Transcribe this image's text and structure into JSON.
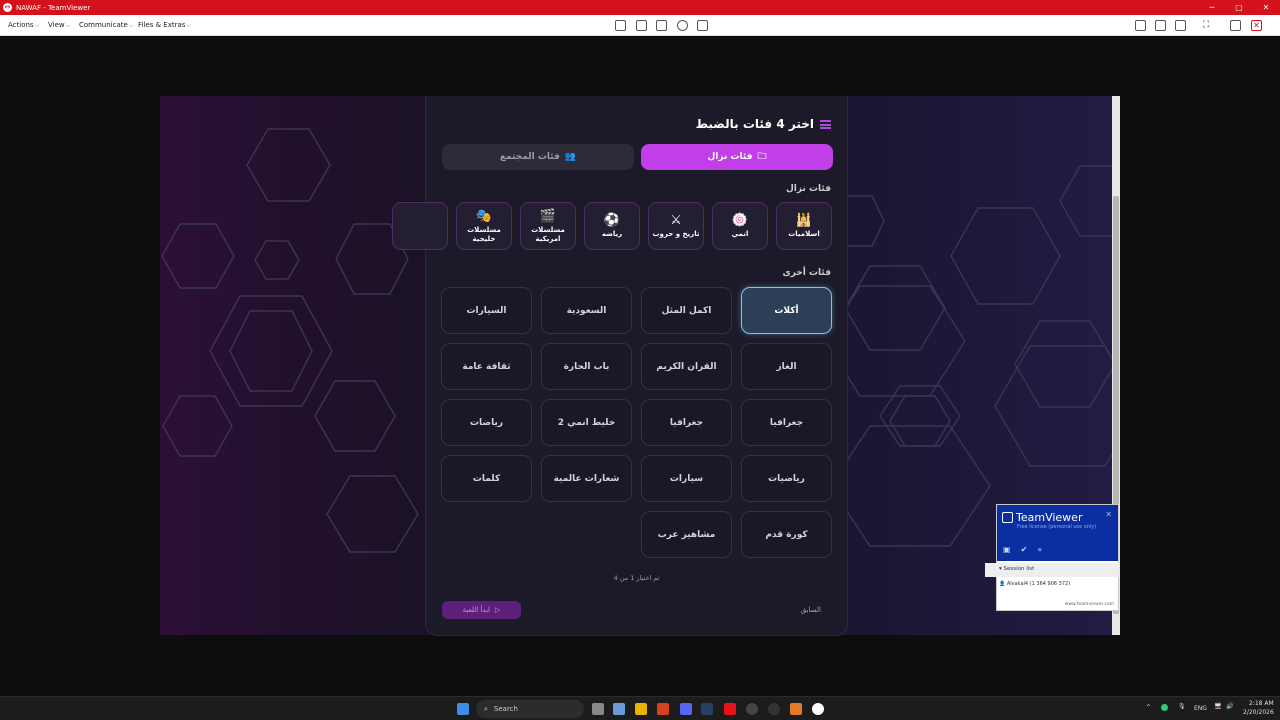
{
  "window": {
    "title": "NAWAF - TeamViewer"
  },
  "menu": [
    {
      "label": "Actions"
    },
    {
      "label": "View"
    },
    {
      "label": "Communicate"
    },
    {
      "label": "Files & Extras"
    }
  ],
  "panel": {
    "heading": "اختر 4 فئات بالضبط",
    "tabs": {
      "nazal": "فئات نزال",
      "community": "فئات المجتمع"
    },
    "nazal_label": "فئات نزال",
    "other_label": "فئات أخرى",
    "nazal_categories": [
      {
        "label": "اسلاميات",
        "icon": "🕌"
      },
      {
        "label": "انمي",
        "icon": "🍥"
      },
      {
        "label": "تاريخ و حروب",
        "icon": "⚔"
      },
      {
        "label": "رياضه",
        "icon": "⚽"
      },
      {
        "label": "مسلسلات امريكية",
        "icon": "🎬"
      },
      {
        "label": "مسلسلات خليجية",
        "icon": "🎭"
      }
    ],
    "options": [
      "أكلات",
      "اكمل المثل",
      "السعودية",
      "السيارات",
      "الغاز",
      "القران الكريم",
      "باب الحارة",
      "ثقافة عامة",
      "جغرافيا",
      "جغرافيا",
      "خليط انمي 2",
      "رياضات",
      "رياضيات",
      "سيارات",
      "شعارات عالمية",
      "كلمات",
      "كورة قدم",
      "مشاهير عرب"
    ],
    "selected_option": "أكلات",
    "count_text": "تم اختيار 1 من 4",
    "start_button": "ابدأ اللعبة",
    "prev_button": "السابق"
  },
  "tv_widget": {
    "brand": "TeamViewer",
    "license": "Free license (personal use only)",
    "session_label": "Session list",
    "user": "Alvakal4 (1 364 906 372)",
    "url": "www.teamviewer.com"
  },
  "taskbar": {
    "search": "Search",
    "lang": "ENG",
    "time": "2:18 AM",
    "date": "2/20/2026"
  }
}
